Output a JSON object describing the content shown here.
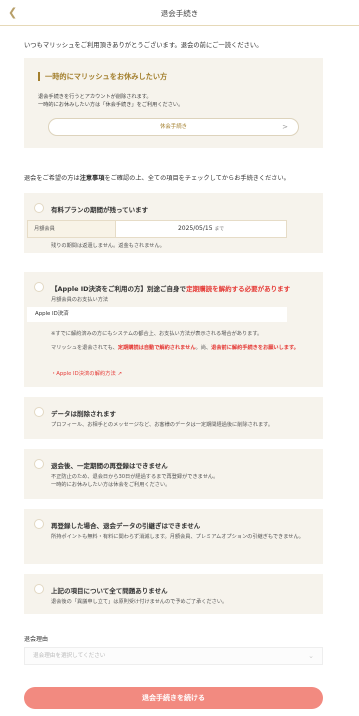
{
  "header": {
    "back_icon": "chevron-left-icon",
    "title": "退会手続き"
  },
  "intro": "いつもマリッシュをご利用頂きありがとうございます。退会の前にご一読ください。",
  "pause": {
    "title": "一時的にマリッシュをお休みしたい方",
    "text_line1": "退会手続きを行うとアカウントが削除されます。",
    "text_line2": "一時的にお休みしたい方は「休会手続き」をご利用ください。",
    "button_label": "休会手続き",
    "button_chevron": ">"
  },
  "notice_prefix": "退会をご希望の方は",
  "notice_bold": "注意事項",
  "notice_suffix": "をご確認の上、全ての項目をチェックしてからお手続きください。",
  "checks": {
    "plan": {
      "title": "有料プランの期間が残っています",
      "table_label": "月額会員",
      "table_value": "2025/05/15",
      "table_unit": "まで",
      "text": "残りの期間は返還しません。返金もされません。"
    },
    "apple": {
      "title_part1": "【Apple ID決済をご利用の方】別途ご自身で",
      "title_part2": "定期購読を解約する必要があります",
      "method_label": "月額会員のお支払い方法",
      "method_value": "Apple ID決済",
      "note1": "※すでに解約済みの方にもシステムの都合上、お支払い方法が表示される場合があります。",
      "note2_prefix": "マリッシュを退会されても、",
      "note2_red": "定期購読は自動で解約されません",
      "note2_mid": "。尚、",
      "note2_red2": "退会前に解約手続きをお願いします。",
      "link": "・Apple ID決済の解約方法 ↗"
    },
    "data": {
      "title": "データは削除されます",
      "text": "プロフィール、お相手とのメッセージなど、お客様のデータは一定期間経過後に削除されます。"
    },
    "reregister": {
      "title": "退会後、一定期間の再登録はできません",
      "text_line1": "不正防止のため、退会日から30日が経過するまで再登録ができません。",
      "text_line2": "一時的にお休みしたい方は休会をご利用ください。"
    },
    "transfer": {
      "title": "再登録した場合、退会データの引継ぎはできません",
      "text": "所持ポイントも無料・有料に関わらず消滅します。月額会員、プレミアムオプションの引継ぎもできません。"
    },
    "confirm": {
      "title": "上記の項目について全て問題ありません",
      "text": "退会後の「異議申し立て」は原則受け付けませんので予めご了承ください。"
    }
  },
  "reason": {
    "label": "退会理由",
    "placeholder": "退会理由を選択してください",
    "chevron": "⌄"
  },
  "submit_label": "退会手続きを続ける"
}
